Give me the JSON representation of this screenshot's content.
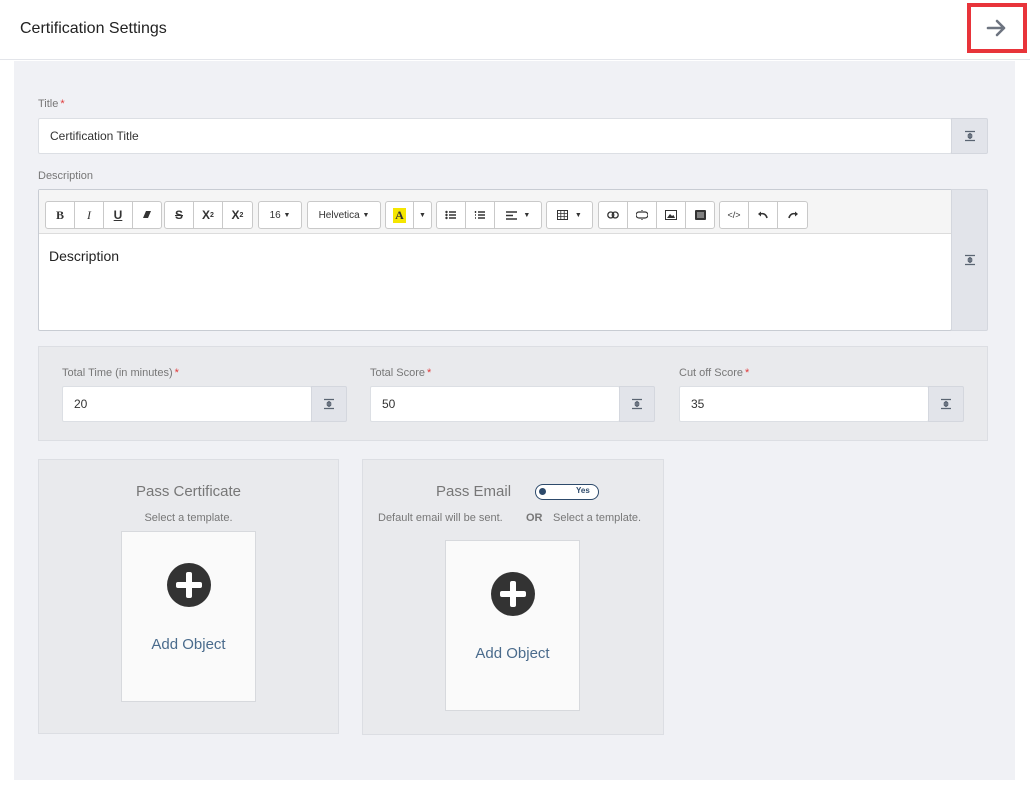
{
  "header": {
    "title": "Certification Settings",
    "next_icon": "arrow-right-icon"
  },
  "form": {
    "title_label": "Title",
    "title_required": "*",
    "title_value": "Certification Title",
    "description_label": "Description",
    "description_value": "Description",
    "toolbar": {
      "bold": "B",
      "italic": "I",
      "underline": "U",
      "strike": "S",
      "superscript": "X",
      "superscript_mark": "2",
      "subscript": "X",
      "subscript_mark": "2",
      "font_size": "16",
      "font_name": "Helvetica",
      "color": "A",
      "code": "</>"
    },
    "total_time": {
      "label": "Total Time (in minutes)",
      "required": "*",
      "value": "20"
    },
    "total_score": {
      "label": "Total Score",
      "required": "*",
      "value": "50"
    },
    "cutoff_score": {
      "label": "Cut off Score",
      "required": "*",
      "value": "35"
    }
  },
  "pass_certificate": {
    "title": "Pass Certificate",
    "subtitle": "Select a template.",
    "add_label": "Add Object"
  },
  "pass_email": {
    "title": "Pass Email",
    "toggle_label": "Yes",
    "default_text": "Default email will be sent.",
    "or_text": "OR",
    "select_text": "Select a template.",
    "add_label": "Add Object"
  },
  "colors": {
    "accent": "#e8343a",
    "link": "#4a6b8c",
    "toggle": "#2d4a6b",
    "highlight": "#f5e600"
  }
}
